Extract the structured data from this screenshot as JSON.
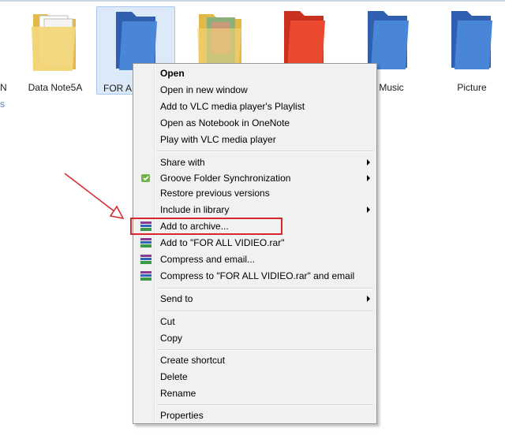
{
  "folders": [
    {
      "label": "Data Note5A",
      "style": "yellow-docs"
    },
    {
      "label": "FOR AL",
      "style": "blue",
      "selected": true
    },
    {
      "label": "",
      "style": "yellow-photo"
    },
    {
      "label": "",
      "style": "red"
    },
    {
      "label": "Music",
      "style": "blue"
    },
    {
      "label": "Picture",
      "style": "blue"
    }
  ],
  "edge_labels": [
    "N",
    "s"
  ],
  "menu": {
    "items": [
      {
        "label": "Open",
        "bold": true
      },
      {
        "label": "Open in new window"
      },
      {
        "label": "Add to VLC media player's Playlist"
      },
      {
        "label": "Open as Notebook in OneNote"
      },
      {
        "label": "Play with VLC media player"
      },
      {
        "label": "Share with",
        "submenu": true
      },
      {
        "label": "Groove Folder Synchronization",
        "submenu": true,
        "icon": "groove-icon"
      },
      {
        "label": "Restore previous versions"
      },
      {
        "label": "Include in library",
        "submenu": true
      },
      {
        "label": "Add to archive...",
        "icon": "winrar-icon",
        "highlighted": true
      },
      {
        "label": "Add to \"FOR ALL VIDIEO.rar\"",
        "icon": "winrar-icon"
      },
      {
        "label": "Compress and email...",
        "icon": "winrar-icon"
      },
      {
        "label": "Compress to \"FOR ALL VIDIEO.rar\" and email",
        "icon": "winrar-icon"
      },
      {
        "label": "Send to",
        "submenu": true
      },
      {
        "label": "Cut"
      },
      {
        "label": "Copy"
      },
      {
        "label": "Create shortcut"
      },
      {
        "label": "Delete"
      },
      {
        "label": "Rename"
      },
      {
        "label": "Properties"
      }
    ]
  },
  "colors": {
    "highlight_border": "#d9262a",
    "arrow": "#d9262a",
    "folder_blue": "#3f76c9",
    "folder_yellow": "#f1cf6b",
    "folder_red": "#e8432c"
  }
}
